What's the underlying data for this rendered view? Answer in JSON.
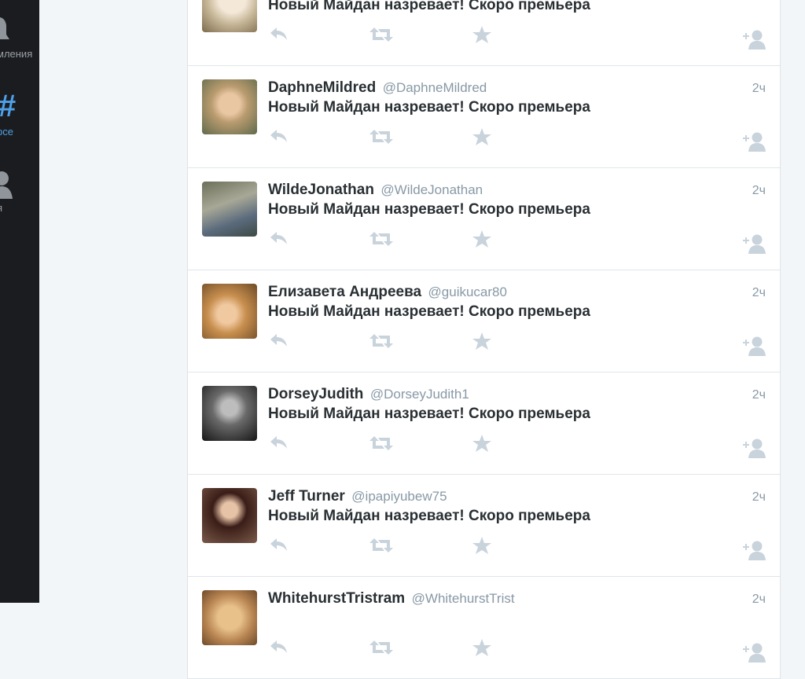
{
  "sidebar": {
    "items": [
      {
        "label": "мления",
        "icon": "bell-icon"
      },
      {
        "label": "рсе",
        "icon": "hashtag-icon",
        "active": true
      },
      {
        "label": "я",
        "icon": "user-icon"
      }
    ]
  },
  "tweets": [
    {
      "name": "",
      "handle": "",
      "time": "",
      "text": "Новый Майдан назревает! Скоро премьера"
    },
    {
      "name": "DaphneMildred",
      "handle": "@DaphneMildred",
      "time": "2ч",
      "text": "Новый Майдан назревает! Скоро премьера"
    },
    {
      "name": "WildeJonathan",
      "handle": "@WildeJonathan",
      "time": "2ч",
      "text": "Новый Майдан назревает! Скоро премьера"
    },
    {
      "name": "Елизавета Андреева",
      "handle": "@guikucar80",
      "time": "2ч",
      "text": "Новый Майдан назревает! Скоро премьера"
    },
    {
      "name": "DorseyJudith",
      "handle": "@DorseyJudith1",
      "time": "2ч",
      "text": "Новый Майдан назревает! Скоро премьера"
    },
    {
      "name": "Jeff Turner",
      "handle": "@ipapiyubew75",
      "time": "2ч",
      "text": "Новый Майдан назревает! Скоро премьера"
    },
    {
      "name": "WhitehurstTristram",
      "handle": "@WhitehurstTrist",
      "time": "2ч",
      "text": ""
    }
  ],
  "colors": {
    "sidebar_bg": "#1b1c1f",
    "accent": "#4ea0e8",
    "action_icon": "#c9d3dc"
  }
}
